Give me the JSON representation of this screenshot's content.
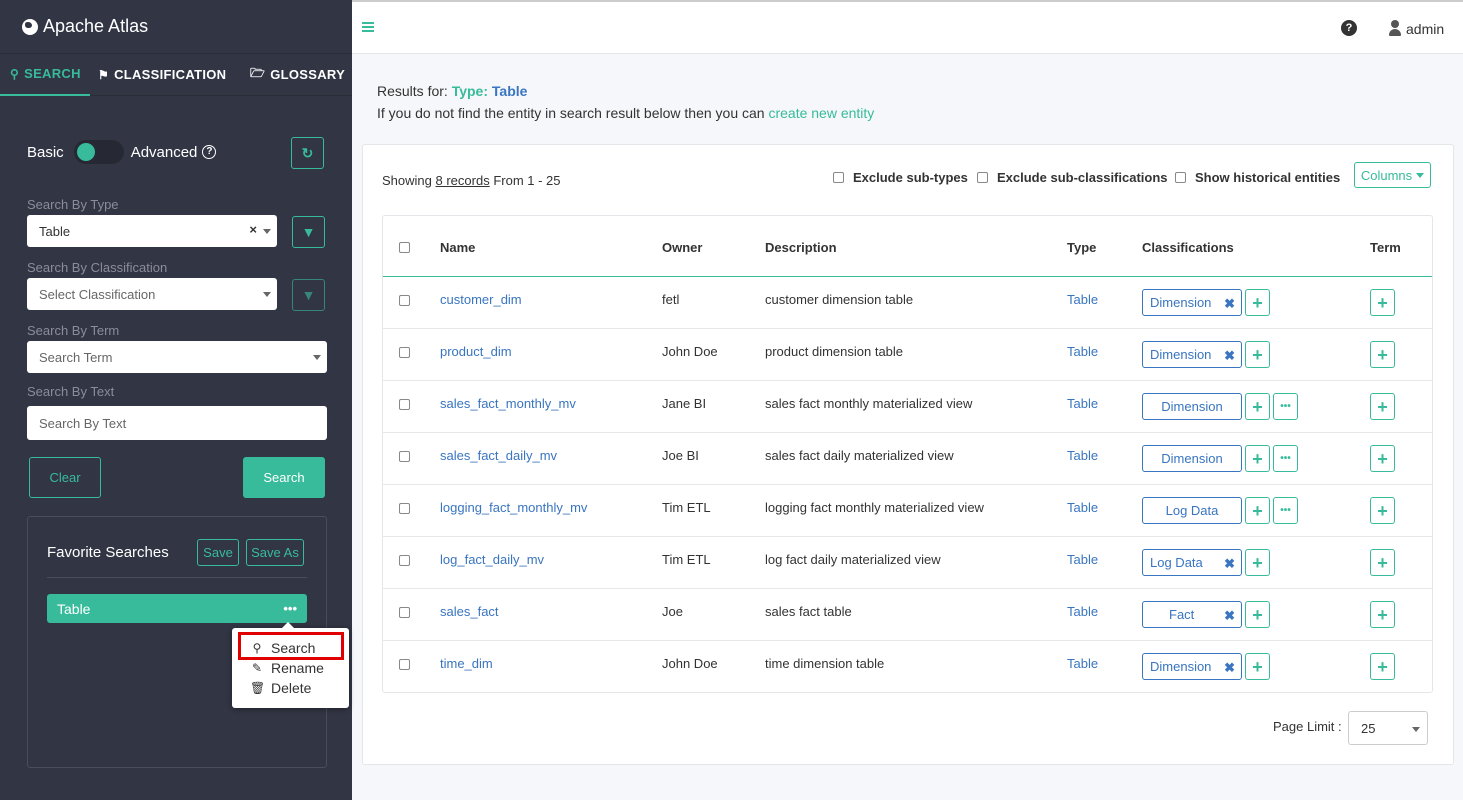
{
  "app": {
    "title": "Apache Atlas"
  },
  "tabs": [
    {
      "label": "SEARCH",
      "icon": "search-icon"
    },
    {
      "label": "CLASSIFICATION",
      "icon": "tag-icon"
    },
    {
      "label": "GLOSSARY",
      "icon": "folder-icon"
    }
  ],
  "search_panel": {
    "basic_label": "Basic",
    "advanced_label": "Advanced",
    "type_label": "Search By Type",
    "type_value": "Table",
    "classification_label": "Search By Classification",
    "classification_placeholder": "Select Classification",
    "term_label": "Search By Term",
    "term_placeholder": "Search Term",
    "text_label": "Search By Text",
    "text_placeholder": "Search By Text",
    "clear_label": "Clear",
    "search_label": "Search"
  },
  "favorites": {
    "title": "Favorite Searches",
    "save_label": "Save",
    "save_as_label": "Save As",
    "items": [
      {
        "label": "Table"
      }
    ],
    "menu": [
      {
        "label": "Search",
        "icon": "search-icon"
      },
      {
        "label": "Rename",
        "icon": "pencil-icon"
      },
      {
        "label": "Delete",
        "icon": "trash-icon"
      }
    ]
  },
  "header": {
    "user": "admin"
  },
  "results": {
    "prefix": "Results for:",
    "type_key": "Type:",
    "type_value": "Table",
    "hint_text": "If you do not find the entity in search result below then you can",
    "hint_link": "create new entity",
    "showing_prefix": "Showing",
    "showing_count": "8 records",
    "showing_suffix": "From 1 - 25",
    "exclude_subtypes": "Exclude sub-types",
    "exclude_subclassifications": "Exclude sub-classifications",
    "show_historical": "Show historical entities",
    "columns_label": "Columns"
  },
  "table": {
    "headers": [
      "Name",
      "Owner",
      "Description",
      "Type",
      "Classifications",
      "Term"
    ],
    "rows": [
      {
        "name": "customer_dim",
        "owner": "fetl",
        "description": "customer dimension table",
        "type": "Table",
        "classification": "Dimension"
      },
      {
        "name": "product_dim",
        "owner": "John Doe",
        "description": "product dimension table",
        "type": "Table",
        "classification": "Dimension"
      },
      {
        "name": "sales_fact_monthly_mv",
        "owner": "Jane BI",
        "description": "sales fact monthly materialized view",
        "type": "Table",
        "classification": "Dimension"
      },
      {
        "name": "sales_fact_daily_mv",
        "owner": "Joe BI",
        "description": "sales fact daily materialized view",
        "type": "Table",
        "classification": "Dimension"
      },
      {
        "name": "logging_fact_monthly_mv",
        "owner": "Tim ETL",
        "description": "logging fact monthly materialized view",
        "type": "Table",
        "classification": "Log Data"
      },
      {
        "name": "log_fact_daily_mv",
        "owner": "Tim ETL",
        "description": "log fact daily materialized view",
        "type": "Table",
        "classification": "Log Data"
      },
      {
        "name": "sales_fact",
        "owner": "Joe",
        "description": "sales fact table",
        "type": "Table",
        "classification": "Fact"
      },
      {
        "name": "time_dim",
        "owner": "John Doe",
        "description": "time dimension table",
        "type": "Table",
        "classification": "Dimension"
      }
    ]
  },
  "pagination": {
    "label": "Page Limit :",
    "value": "25"
  },
  "colors": {
    "accent": "#37bb9b",
    "link": "#3975c0",
    "sidebar": "#323544"
  }
}
